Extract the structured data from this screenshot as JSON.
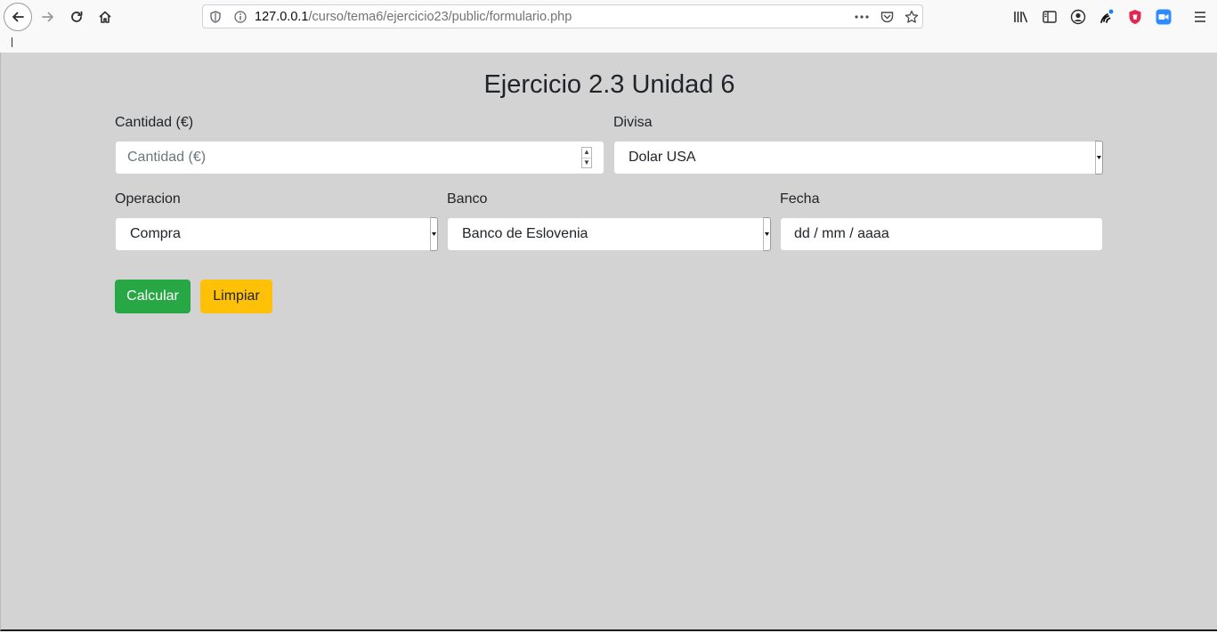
{
  "browser": {
    "url_host": "127.0.0.1",
    "url_path": "/curso/tema6/ejercicio23/public/formulario.php",
    "icons": [
      "back-icon",
      "forward-icon",
      "reload-icon",
      "home-icon",
      "shield-icon",
      "info-icon",
      "more-icon",
      "pocket-icon",
      "star-icon",
      "library-icon",
      "sidebar-icon",
      "account-icon",
      "extension-icon",
      "brave-shield-icon",
      "zoom-icon",
      "menu-icon"
    ]
  },
  "form": {
    "title": "Ejercicio 2.3 Unidad 6",
    "cantidad": {
      "label": "Cantidad (€)",
      "placeholder": "Cantidad (€)"
    },
    "divisa": {
      "label": "Divisa",
      "selected": "Dolar USA"
    },
    "operacion": {
      "label": "Operacion",
      "selected": "Compra"
    },
    "banco": {
      "label": "Banco",
      "selected": "Banco de Eslovenia"
    },
    "fecha": {
      "label": "Fecha",
      "placeholder": "dd / mm / aaaa"
    },
    "buttons": {
      "calcular": "Calcular",
      "limpiar": "Limpiar"
    }
  },
  "colors": {
    "page_background": "#d3d3d3",
    "calcular_button": "#28a745",
    "limpiar_button": "#ffc107"
  }
}
